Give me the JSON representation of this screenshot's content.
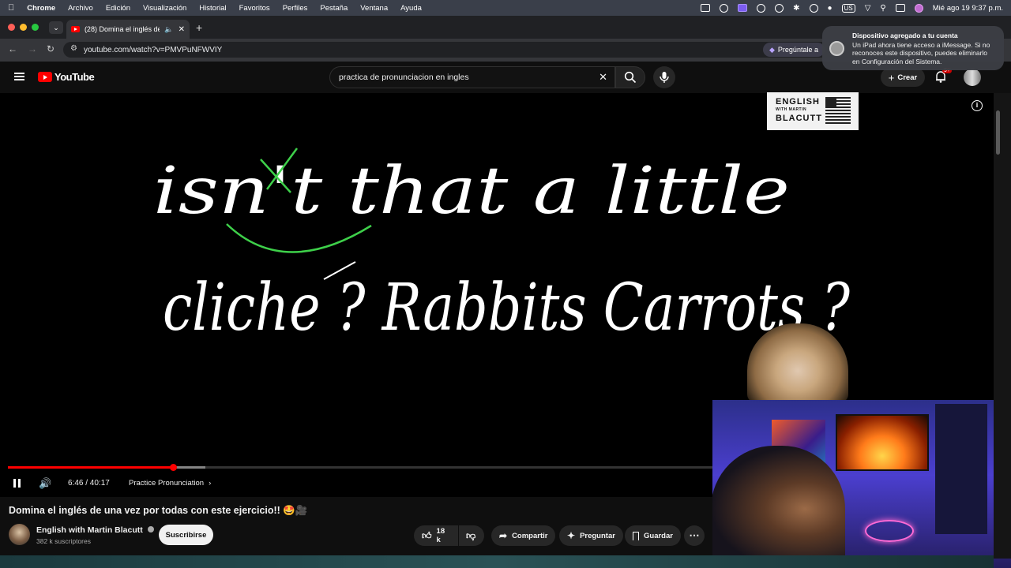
{
  "menubar": {
    "apple": "",
    "app": "Chrome",
    "items": [
      "Archivo",
      "Edición",
      "Visualización",
      "Historial",
      "Favoritos",
      "Perfiles",
      "Pestaña",
      "Ventana",
      "Ayuda"
    ],
    "keyboard_layout": "US",
    "datetime": "Mié ago 19  9:37 p.m."
  },
  "browser": {
    "tab_title": "(28) Domina el inglés de u",
    "url": "youtube.com/watch?v=PMVPuNFWVIY",
    "gemini_button": "Pregúntale a"
  },
  "notification": {
    "title": "Dispositivo agregado a tu cuenta",
    "body": "Un iPad ahora tiene acceso a iMessage. Si no reconoces este dispositivo, puedes eliminarlo en Configuración del Sistema."
  },
  "youtube": {
    "logo_text": "YouTube",
    "search_value": "practica de pronunciacion en ingles",
    "create_label": "Crear",
    "notifications_badge": "9+"
  },
  "video": {
    "logo_line1": "ENGLISH",
    "logo_line2": "WITH MARTIN",
    "logo_line3": "BLACUTT",
    "handwriting_line1": "isn't that a little",
    "handwriting_line2": "cliche ? Rabbits Carrots ?",
    "time_current": "6:46",
    "time_total": "40:17",
    "time_display": "6:46 / 40:17",
    "chapter": "Practice Pronunciation",
    "progress_fraction": 0.169
  },
  "info": {
    "title": "Domina el inglés de una vez por todas con este ejercicio!! 🤩🎥",
    "channel": "English with Martin Blacutt",
    "subscribers": "382 k suscriptores",
    "subscribe_label": "Suscribirse",
    "likes": "18 k",
    "share_label": "Compartir",
    "ask_label": "Preguntar",
    "save_label": "Guardar"
  },
  "colors": {
    "accent_red": "#ff0000",
    "bg": "#0f0f0f",
    "chip": "#272727"
  }
}
